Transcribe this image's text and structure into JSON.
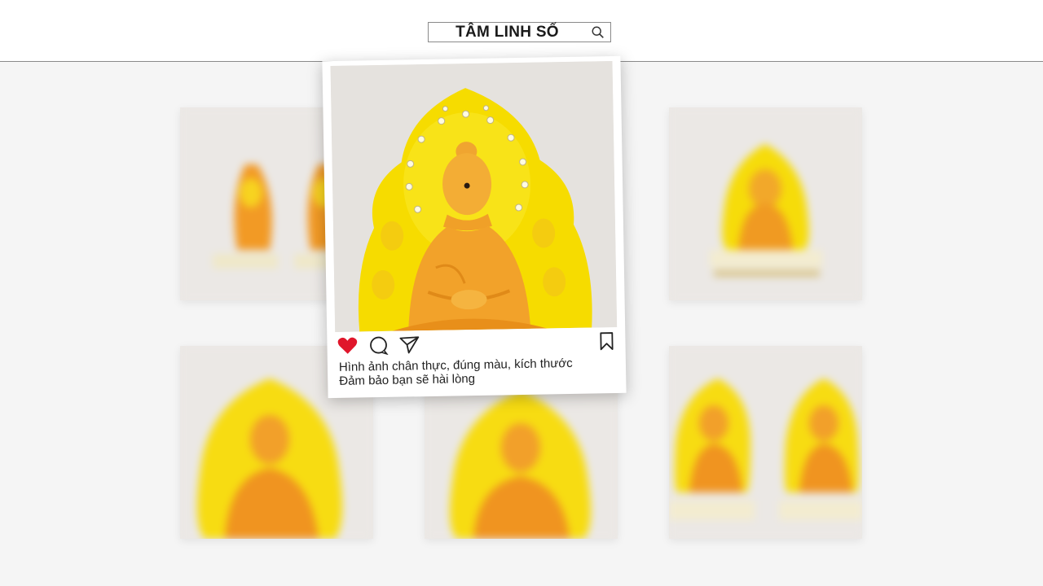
{
  "header": {
    "search_text": "TÂM LINH SỐ",
    "search_icon": "search-icon"
  },
  "post": {
    "caption_line1": "Hình ảnh chân thực, đúng màu, kích thước",
    "caption_line2": "Đảm bảo bạn sẽ hài lòng",
    "icons": [
      "heart-icon",
      "comment-icon",
      "share-icon",
      "bookmark-icon"
    ],
    "like_color": "#e0162b"
  },
  "colors": {
    "halo_yellow": "#f6dc00",
    "buddha_amber": "#f0a020",
    "background": "#f5f5f5"
  }
}
